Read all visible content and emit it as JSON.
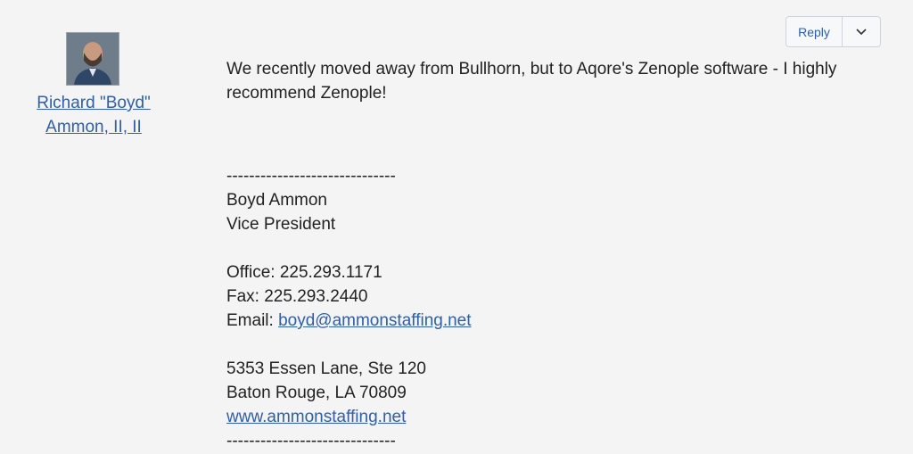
{
  "author": {
    "name_line1": "Richard \"Boyd\"",
    "name_line2": "Ammon, II, II",
    "avatar_icon": "person-photo-icon"
  },
  "actions": {
    "reply_label": "Reply",
    "more_icon": "chevron-down-icon"
  },
  "message": {
    "body": "We recently moved away from Bullhorn, but to Aqore's Zenople software - I highly recommend Zenople!",
    "signature": {
      "divider": "------------------------------",
      "name": "Boyd Ammon",
      "title": "Vice President",
      "office_label": "Office:",
      "office": "225.293.1171",
      "fax_label": "Fax:",
      "fax": "225.293.2440",
      "email_label": "Email:",
      "email": "boyd@ammonstaffing.net",
      "address_line1": "5353 Essen Lane, Ste 120",
      "address_line2": "Baton Rouge, LA 70809",
      "website": "www.ammonstaffing.net"
    }
  }
}
